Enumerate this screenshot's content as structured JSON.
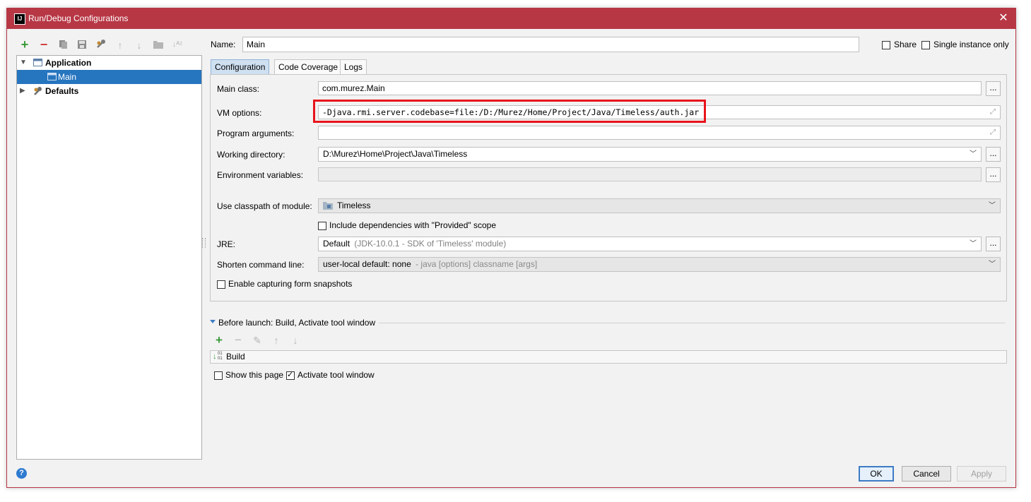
{
  "window": {
    "title": "Run/Debug Configurations",
    "app_icon": "IJ",
    "close_glyph": "✕"
  },
  "toolbar": {
    "icons": [
      "add-icon",
      "remove-icon",
      "copy-icon",
      "save-icon",
      "edit-defaults-icon",
      "move-up-icon",
      "move-down-icon",
      "folder-icon",
      "sort-icon"
    ]
  },
  "tree": {
    "items": [
      {
        "label": "Application",
        "expanded": true,
        "bold": true
      },
      {
        "label": "Main",
        "selected": true
      },
      {
        "label": "Defaults",
        "expanded": false,
        "bold": true
      }
    ]
  },
  "header": {
    "name_label": "Name:",
    "name_value": "Main",
    "share_label": "Share",
    "single_instance_label": "Single instance only"
  },
  "tabs": [
    {
      "label": "Configuration",
      "active": true
    },
    {
      "label": "Code Coverage"
    },
    {
      "label": "Logs"
    }
  ],
  "config": {
    "main_class_label": "Main class:",
    "main_class_value": "com.murez.Main",
    "vm_options_label": "VM options:",
    "vm_options_value": "-Djava.rmi.server.codebase=file:/D:/Murez/Home/Project/Java/Timeless/auth.jar",
    "program_args_label": "Program arguments:",
    "program_args_value": "",
    "working_dir_label": "Working directory:",
    "working_dir_value": "D:\\Murez\\Home\\Project\\Java\\Timeless",
    "env_vars_label": "Environment variables:",
    "env_vars_value": "",
    "classpath_label": "Use classpath of module:",
    "classpath_value": "Timeless",
    "include_deps_label": "Include dependencies with \"Provided\" scope",
    "jre_label": "JRE:",
    "jre_value": "Default",
    "jre_detail": "(JDK-10.0.1 - SDK of 'Timeless' module)",
    "shorten_label": "Shorten command line:",
    "shorten_value": "user-local default: none",
    "shorten_detail": "- java [options] classname [args]",
    "snapshots_label": "Enable capturing form snapshots",
    "dots": "..."
  },
  "before_launch": {
    "label": "Before launch: Build, Activate tool window",
    "items": [
      "Build"
    ],
    "show_page_label": "Show this page",
    "activate_label": "Activate tool window",
    "activate_checked": true
  },
  "buttons": {
    "help": "?",
    "ok": "OK",
    "cancel": "Cancel",
    "apply": "Apply"
  },
  "colors": {
    "title_bar": "#b73745",
    "selection": "#2675bf",
    "highlight_box": "#e8141b",
    "add_green": "#3a9a3a",
    "remove_red": "#d04040"
  }
}
